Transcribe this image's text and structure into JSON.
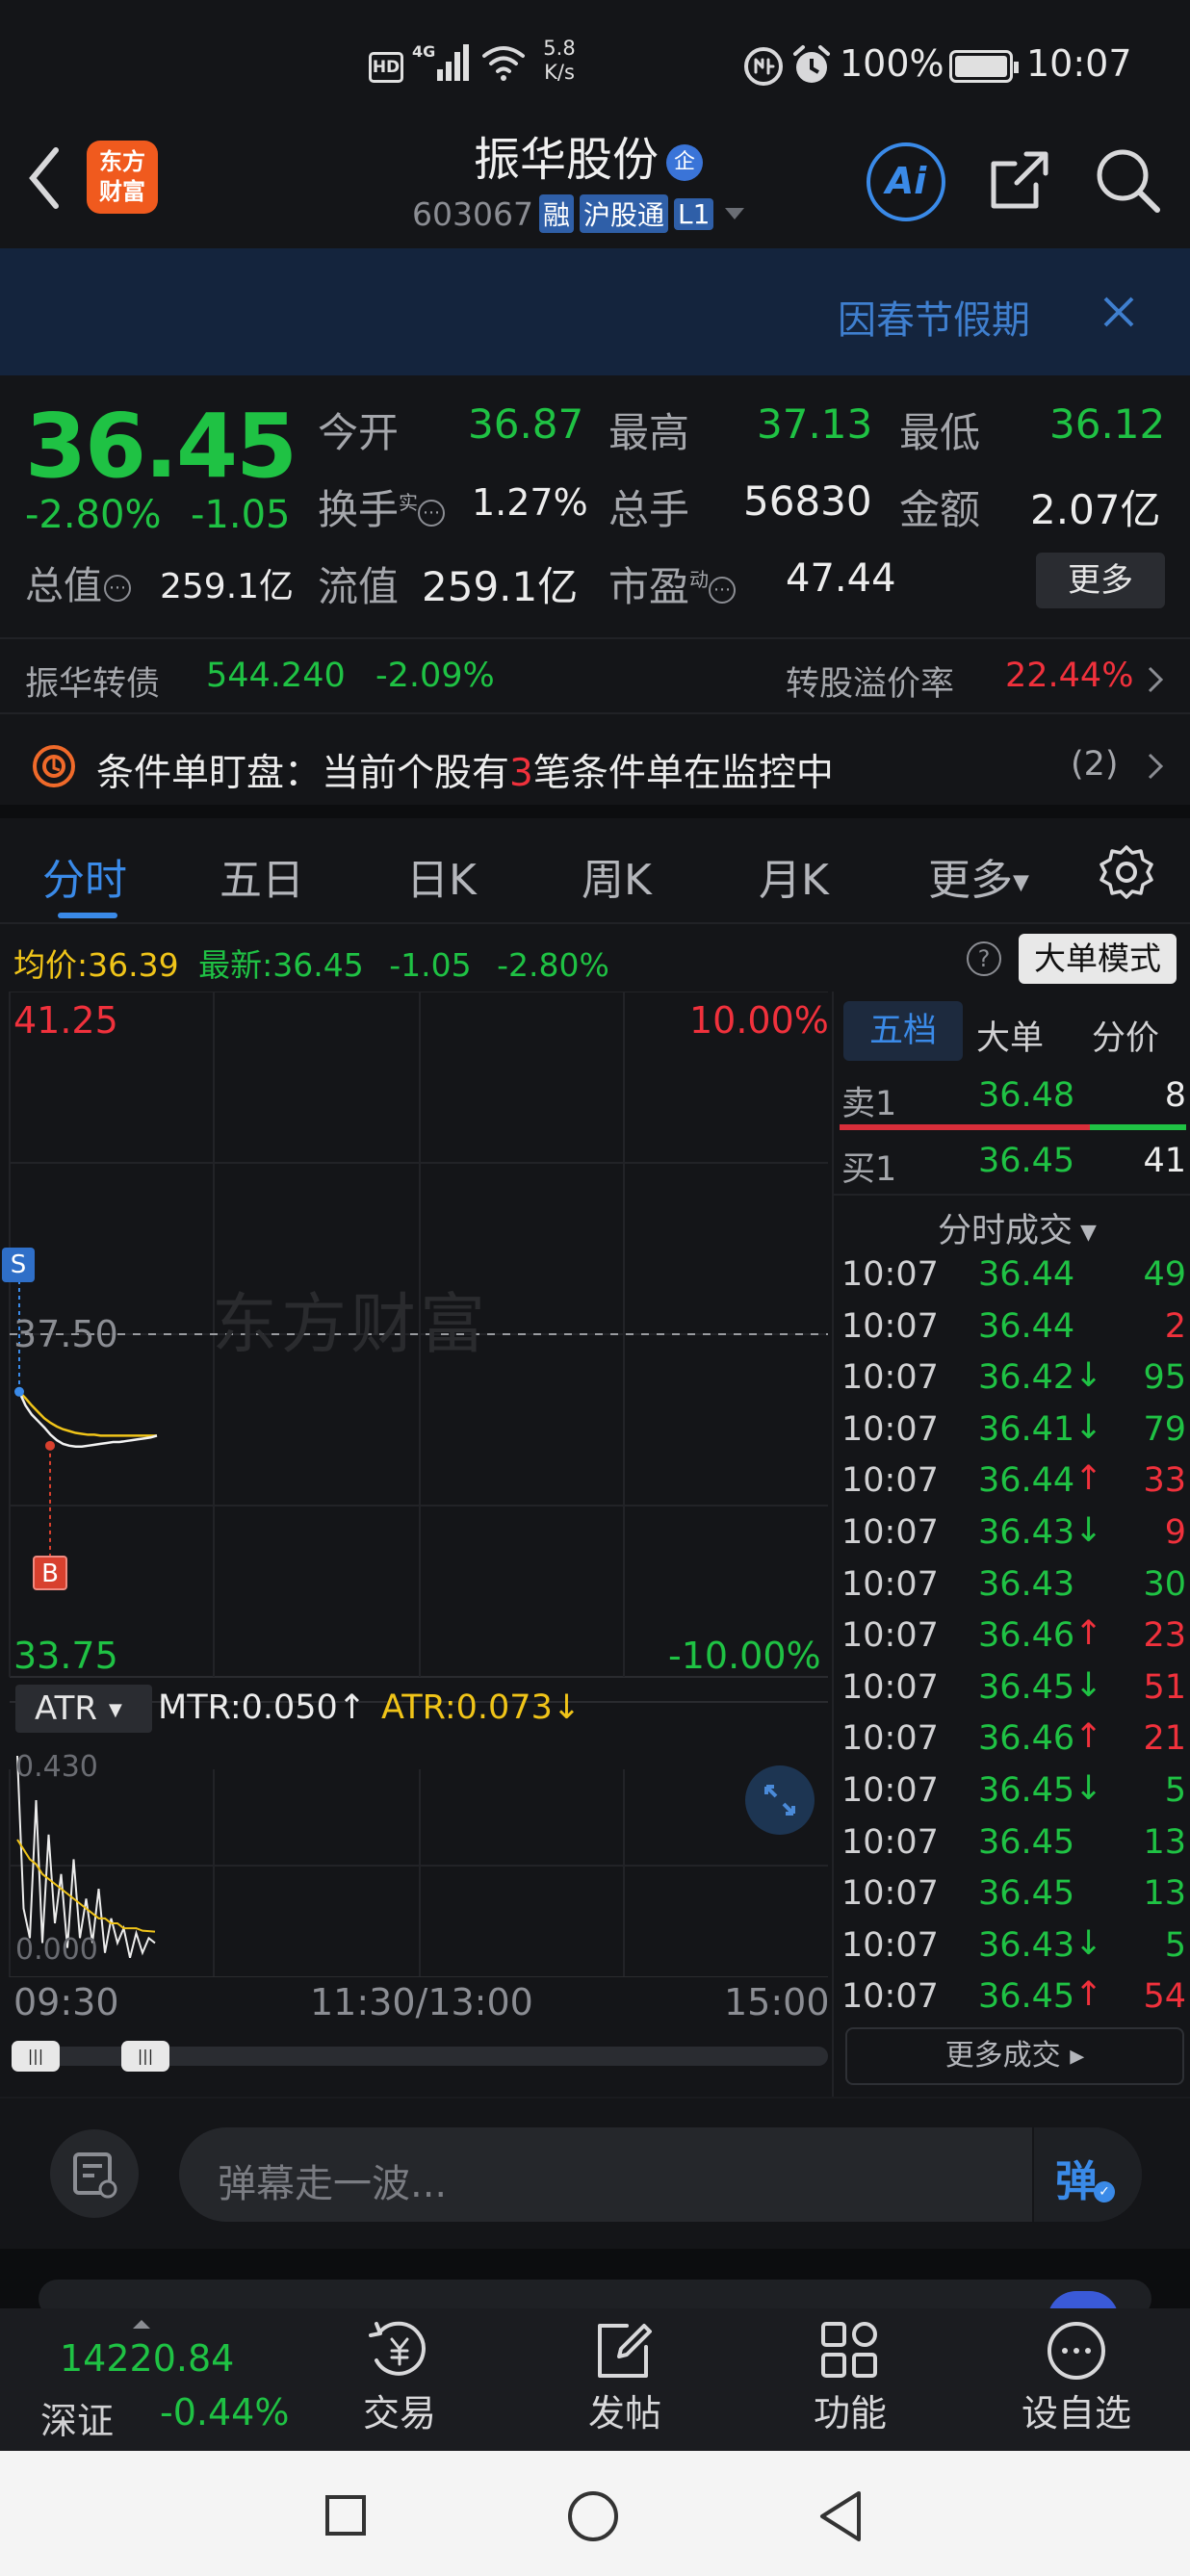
{
  "status": {
    "net_speed": "5.8",
    "net_unit": "K/s",
    "battery": "100%",
    "time": "10:07"
  },
  "header": {
    "logo": "东方\n财富",
    "name": "振华股份",
    "badge": "企",
    "code": "603067",
    "tags": [
      "融",
      "沪股通",
      "L1"
    ],
    "ai": "Ai"
  },
  "notice": {
    "text": "因春节假期"
  },
  "quote": {
    "price": "36.45",
    "chg_pct": "-2.80%",
    "chg": "-1.05",
    "rows": [
      [
        {
          "k": "今开",
          "v": "36.87"
        },
        {
          "k": "最高",
          "v": "37.13"
        },
        {
          "k": "最低",
          "v": "36.12"
        }
      ],
      [
        {
          "k": "换手",
          "sup": "实",
          "v": "1.27%"
        },
        {
          "k": "总手",
          "v": "56830"
        },
        {
          "k": "金额",
          "v": "2.07亿"
        }
      ],
      [
        {
          "k": "总值",
          "v": "259.1亿"
        },
        {
          "k": "流值",
          "v": "259.1亿"
        },
        {
          "k": "市盈",
          "sup": "动",
          "v": "47.44"
        }
      ]
    ],
    "more": "更多"
  },
  "bond": {
    "name": "振华转债",
    "price": "544.240",
    "chg": "-2.09%",
    "premium_label": "转股溢价率",
    "premium": "22.44%"
  },
  "cond": {
    "pre": "条件单盯盘：当前个股有",
    "num": "3",
    "post": "笔条件单在监控中",
    "count": "(2)"
  },
  "tabs": [
    "分时",
    "五日",
    "日K",
    "周K",
    "月K",
    "更多"
  ],
  "info": {
    "avg_label": "均价:",
    "avg": "36.39",
    "latest_label": "最新:",
    "latest": "36.45",
    "chg": "-1.05",
    "pct": "-2.80%",
    "mode": "大单模式"
  },
  "chart": {
    "ymax": "41.25",
    "ymax_pct": "10.00%",
    "ymid": "37.50",
    "ymin": "33.75",
    "ymin_pct": "-10.00%",
    "watermark": "东方财富",
    "s": "S",
    "b": "B",
    "x_labels": [
      "09:30",
      "11:30/13:00",
      "15:00"
    ],
    "price": [
      36.87,
      36.72,
      36.62,
      36.55,
      36.48,
      36.4,
      36.34,
      36.3,
      36.28,
      36.27,
      36.27,
      36.28,
      36.29,
      36.3,
      36.31,
      36.32,
      36.32,
      36.33,
      36.34,
      36.35,
      36.36,
      36.37,
      36.39
    ],
    "avg": [
      36.87,
      36.8,
      36.72,
      36.65,
      36.58,
      36.53,
      36.49,
      36.46,
      36.44,
      36.42,
      36.41,
      36.4,
      36.4,
      36.39,
      36.39,
      36.39,
      36.39,
      36.39,
      36.39,
      36.39,
      36.39,
      36.39,
      36.39
    ]
  },
  "atr": {
    "sel": "ATR",
    "mtr": "MTR:0.050",
    "atr": "ATR:0.073",
    "max": "0.430",
    "min": "0.000",
    "mtr_vals": [
      0.43,
      0.12,
      0.06,
      0.34,
      0.05,
      0.27,
      0.09,
      0.19,
      0.04,
      0.22,
      0.06,
      0.14,
      0.05,
      0.16,
      0.03,
      0.1,
      0.05,
      0.08,
      0.02,
      0.07,
      0.03,
      0.06,
      0.05
    ],
    "atr_vals": [
      0.26,
      0.24,
      0.22,
      0.21,
      0.19,
      0.18,
      0.17,
      0.16,
      0.15,
      0.14,
      0.13,
      0.12,
      0.11,
      0.1,
      0.1,
      0.09,
      0.09,
      0.08,
      0.08,
      0.08,
      0.075,
      0.074,
      0.073
    ]
  },
  "book": {
    "tabs": [
      "五档",
      "大单",
      "分价"
    ],
    "sell": {
      "label": "卖1",
      "price": "36.48",
      "vol": "8"
    },
    "buy": {
      "label": "买1",
      "price": "36.45",
      "vol": "41"
    },
    "ticks_title": "分时成交",
    "ticks": [
      {
        "t": "10:07",
        "p": "36.44",
        "a": "",
        "v": "49",
        "c": "g"
      },
      {
        "t": "10:07",
        "p": "36.44",
        "a": "",
        "v": "2",
        "c": "r"
      },
      {
        "t": "10:07",
        "p": "36.42",
        "a": "↓",
        "v": "95",
        "c": "g"
      },
      {
        "t": "10:07",
        "p": "36.41",
        "a": "↓",
        "v": "79",
        "c": "g"
      },
      {
        "t": "10:07",
        "p": "36.44",
        "a": "↑",
        "v": "33",
        "c": "r"
      },
      {
        "t": "10:07",
        "p": "36.43",
        "a": "↓",
        "v": "9",
        "c": "r"
      },
      {
        "t": "10:07",
        "p": "36.43",
        "a": "",
        "v": "30",
        "c": "g"
      },
      {
        "t": "10:07",
        "p": "36.46",
        "a": "↑",
        "v": "23",
        "c": "r"
      },
      {
        "t": "10:07",
        "p": "36.45",
        "a": "↓",
        "v": "51",
        "c": "r"
      },
      {
        "t": "10:07",
        "p": "36.46",
        "a": "↑",
        "v": "21",
        "c": "r"
      },
      {
        "t": "10:07",
        "p": "36.45",
        "a": "↓",
        "v": "5",
        "c": "g"
      },
      {
        "t": "10:07",
        "p": "36.45",
        "a": "",
        "v": "13",
        "c": "g"
      },
      {
        "t": "10:07",
        "p": "36.45",
        "a": "",
        "v": "13",
        "c": "g"
      },
      {
        "t": "10:07",
        "p": "36.43",
        "a": "↓",
        "v": "5",
        "c": "g"
      },
      {
        "t": "10:07",
        "p": "36.45",
        "a": "↑",
        "v": "54",
        "c": "r"
      }
    ],
    "more": "更多成交"
  },
  "danmu": {
    "placeholder": "弹幕走一波...",
    "btn": "弹"
  },
  "bottom": {
    "index_val": "14220.84",
    "index_name": "深证",
    "index_chg": "-0.44%",
    "items": [
      "交易",
      "发帖",
      "功能",
      "设自选"
    ]
  }
}
